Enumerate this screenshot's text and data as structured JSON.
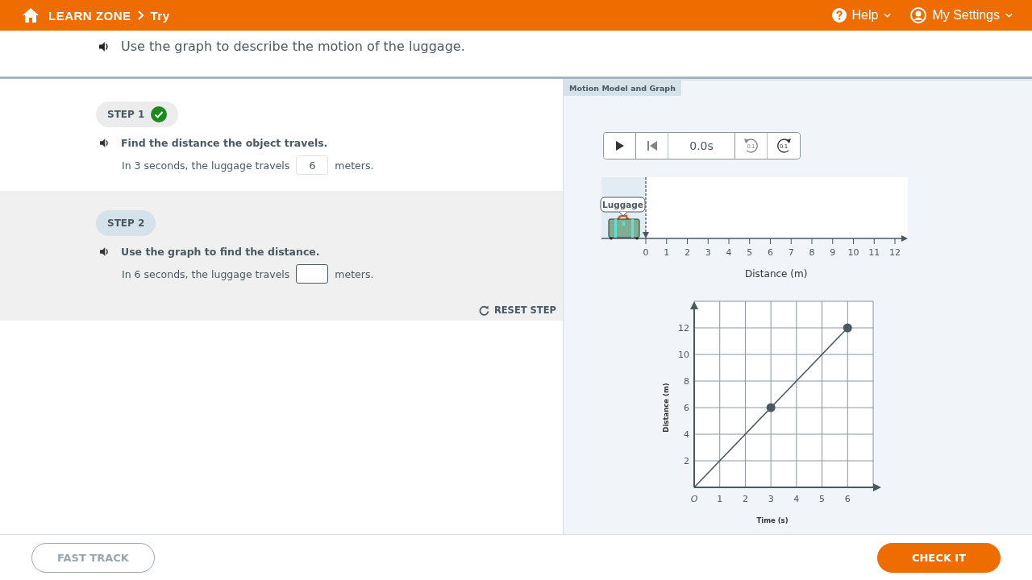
{
  "header": {
    "breadcrumb": [
      "LEARN ZONE",
      "Try"
    ],
    "menus": [
      {
        "label": "Help",
        "kind": "help"
      },
      {
        "label": "My Settings",
        "kind": "account"
      }
    ]
  },
  "prompt": "Use the graph to describe the motion of the luggage.",
  "steps": [
    {
      "label": "STEP 1",
      "completed": true,
      "active": false,
      "instruction": "Find the distance the object travels.",
      "before": "In 3 seconds, the luggage travels",
      "value": "6",
      "after": "meters."
    },
    {
      "label": "STEP 2",
      "completed": false,
      "active": true,
      "instruction": "Use the graph to find the distance.",
      "before": "In 6 seconds, the luggage travels",
      "after": "meters.",
      "reset": "RESET STEP"
    }
  ],
  "panel": {
    "title": "Motion Model and Graph",
    "player": {
      "time": "0.0s",
      "restart_disabled": true,
      "back_label": "0.1",
      "back_disabled": true,
      "forward_label": "0.1",
      "forward_disabled": false
    },
    "number_line": {
      "object": "Luggage",
      "ticks": [
        "0",
        "1",
        "2",
        "3",
        "4",
        "5",
        "6",
        "7",
        "8",
        "9",
        "10",
        "11",
        "12"
      ],
      "axis_label": "Distance (m)"
    },
    "chart_data": {
      "type": "line",
      "xlabel": "Time (s)",
      "ylabel": "Distance (m)",
      "x": [
        0,
        3,
        6
      ],
      "series": [
        {
          "color": "#4a5860",
          "values": [
            0,
            6,
            12
          ]
        }
      ],
      "xlim": [
        0,
        7
      ],
      "ylim": [
        0,
        14
      ],
      "grid": true,
      "xticks": [
        {
          "value": 0,
          "label": "O"
        },
        1,
        2,
        3,
        4,
        5,
        6
      ],
      "yticks": [
        2,
        4,
        6,
        8,
        10,
        12
      ]
    }
  },
  "footer": {
    "buttons": [
      {
        "label": "FAST TRACK",
        "kind": "secondary"
      },
      {
        "label": "CHECK IT",
        "kind": "primary"
      }
    ]
  }
}
